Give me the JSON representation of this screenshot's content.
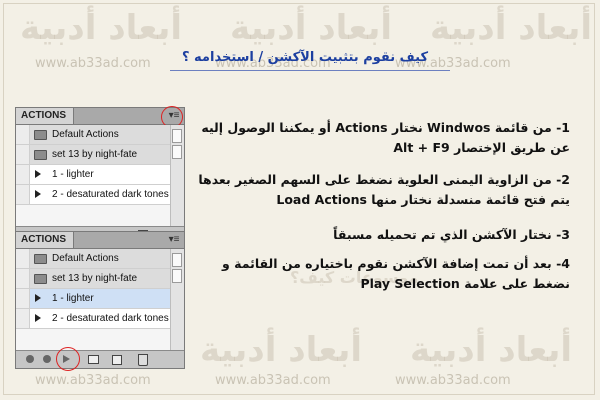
{
  "watermark": {
    "brand_text": "أبعاد أدبية",
    "url_text": "www.ab33ad.com",
    "faded_phrase": "موسوعات كيف؟"
  },
  "page_title": "كيف نقوم بتثبيت الآكشن / استخدامه ؟",
  "panels": [
    {
      "tab_label": "ACTIONS",
      "menu_icon": "panel-menu-icon",
      "highlight": "menu",
      "rows": [
        {
          "type": "set",
          "label": "Default Actions",
          "icon": "folder-icon"
        },
        {
          "type": "set",
          "label": "set 13 by night-fate",
          "icon": "folder-icon"
        },
        {
          "type": "action",
          "label": "1 - lighter",
          "icon": "triangle-right-icon"
        },
        {
          "type": "action",
          "label": "2 - desaturated dark tones",
          "icon": "triangle-right-icon"
        }
      ]
    },
    {
      "tab_label": "ACTIONS",
      "menu_icon": "panel-menu-icon",
      "highlight": "play",
      "rows": [
        {
          "type": "set",
          "label": "Default Actions",
          "icon": "folder-icon"
        },
        {
          "type": "set",
          "label": "set 13 by night-fate",
          "icon": "folder-icon"
        },
        {
          "type": "action",
          "label": "1 - lighter",
          "icon": "triangle-right-icon",
          "selected": true
        },
        {
          "type": "action",
          "label": "2 - desaturated dark tones",
          "icon": "triangle-right-icon"
        }
      ]
    }
  ],
  "steps": [
    {
      "number": "1-",
      "text": "من قائمة Windwos نختار Actions أو يمكننا الوصول إليه عن طريق الإختصار Alt + F9"
    },
    {
      "number": "2-",
      "text": "من الزاوية اليمنى العلوية نضغط على السهم الصغير بعدها يتم فتح قائمة منسدلة نختار منها Load Actions"
    },
    {
      "number": "3-",
      "text": "نختار الآكشن الذي تم تحميله مسبقاً"
    },
    {
      "number": "4-",
      "text": "بعد أن تمت إضافة الآكشن نقوم باختياره من القائمة و نضغط على علامة Play Selection"
    }
  ],
  "colors": {
    "background": "#f3f0e6",
    "title": "#1c3fa0",
    "highlight_circle": "#dd2222",
    "selected_row": "#cfe0f5"
  }
}
